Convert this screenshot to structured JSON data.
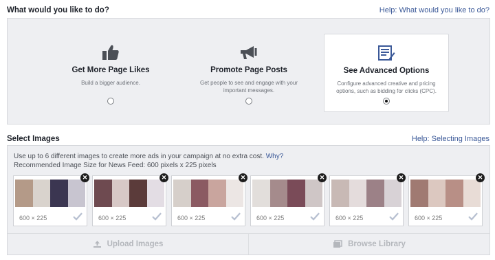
{
  "objective": {
    "heading": "What would you like to do?",
    "help": "Help: What would you like to do?",
    "options": [
      {
        "title": "Get More Page Likes",
        "desc": "Build a bigger audience.",
        "icon": "thumbs-up-icon",
        "selected": false
      },
      {
        "title": "Promote Page Posts",
        "desc": "Get people to see and engage with your important messages.",
        "icon": "megaphone-icon",
        "selected": false
      },
      {
        "title": "See Advanced Options",
        "desc": "Configure advanced creative and pricing options, such as bidding for clicks (CPC).",
        "icon": "advanced-form-icon",
        "selected": true
      }
    ]
  },
  "images": {
    "heading": "Select Images",
    "help": "Help: Selecting Images",
    "info_line1": "Use up to 6 different images to create more ads in your campaign at no extra cost.",
    "why": "Why?",
    "info_line2": "Recommended Image Size for News Feed: 600 pixels x 225 pixels",
    "thumbnails": [
      {
        "size": "600 × 225",
        "colors": [
          "#b49a88",
          "#d9d3cd",
          "#3b3651",
          "#c8c5d0"
        ]
      },
      {
        "size": "600 × 225",
        "colors": [
          "#6e4a50",
          "#d7c8c6",
          "#5b3b3a",
          "#e3dde4"
        ]
      },
      {
        "size": "600 × 225",
        "colors": [
          "#d6cfca",
          "#8b5a62",
          "#c9a59e",
          "#ece6e4"
        ]
      },
      {
        "size": "600 × 225",
        "colors": [
          "#e2dedb",
          "#a58b8c",
          "#7a4b58",
          "#cfc6c6"
        ]
      },
      {
        "size": "600 × 225",
        "colors": [
          "#c8b9b5",
          "#e4dcdc",
          "#9c8187",
          "#d8d2d6"
        ]
      },
      {
        "size": "600 × 225",
        "colors": [
          "#a07a72",
          "#dcc8c0",
          "#b88f86",
          "#e8dcd6"
        ]
      }
    ],
    "upload_label": "Upload Images",
    "browse_label": "Browse Library"
  },
  "colors": {
    "link": "#3b5998",
    "panel": "#eeeff2",
    "disabled_text": "#b4b7bc"
  }
}
